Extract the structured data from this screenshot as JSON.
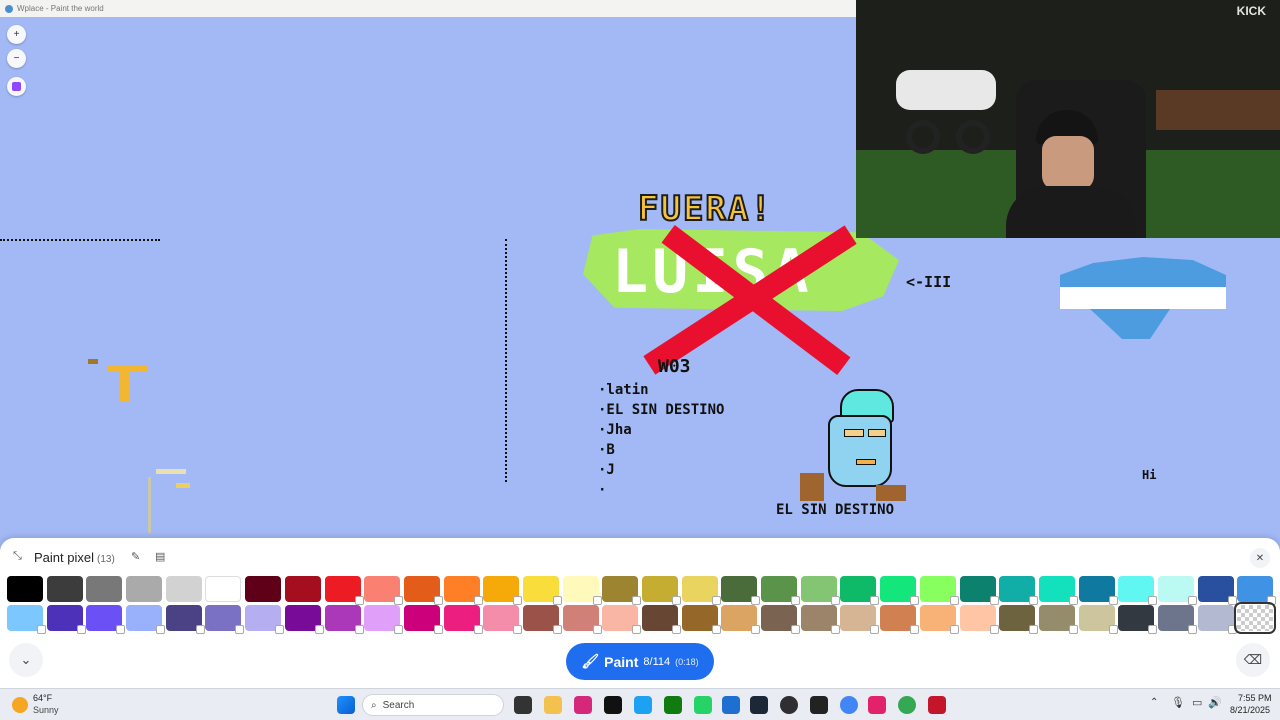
{
  "window": {
    "title": "Wplace - Paint the world"
  },
  "map_controls": {
    "zoom_in": "+",
    "zoom_out": "−"
  },
  "art": {
    "fuera": "FUERA!",
    "luisa": "LUISA",
    "arrow": "<-III",
    "code": "W03",
    "list": [
      "·latin",
      "·EL SIN DESTINO",
      "·Jha",
      "·B",
      "·J",
      "·"
    ],
    "caption": "EL SIN DESTINO",
    "hi": "Hi"
  },
  "panel": {
    "title": "Paint pixel",
    "count": "(13)",
    "paint_label": "Paint",
    "paint_charges": "8/114",
    "paint_timer": "(0:18)"
  },
  "palette": [
    "#000000",
    "#3c3c3c",
    "#787878",
    "#aaaaaa",
    "#d2d2d2",
    "#ffffff",
    "#600018",
    "#a50e1e",
    "#ed1c24",
    "#fa8072",
    "#e45c1a",
    "#ff7f27",
    "#f6aa09",
    "#f9dd3b",
    "#fffabc",
    "#9c8431",
    "#c5ad31",
    "#e8d45f",
    "#4a6b3a",
    "#5a944a",
    "#84c573",
    "#0eb968",
    "#13e67b",
    "#87ff5e",
    "#0c816e",
    "#10aea6",
    "#13e1be",
    "#0f799f",
    "#60f7f2",
    "#bbfaf2",
    "#28509e",
    "#4093e4",
    "#7dc7ff",
    "#4d31b8",
    "#6b50f6",
    "#99b1fb",
    "#4a4284",
    "#7a71c4",
    "#b5aef1",
    "#780c99",
    "#aa38b9",
    "#e09ff9",
    "#cb007a",
    "#ec1f80",
    "#f38da9",
    "#9b5249",
    "#d18078",
    "#fab6a4",
    "#684634",
    "#95682a",
    "#dba463",
    "#7b6352",
    "#9c846b",
    "#d6b594",
    "#d18051",
    "#f8b277",
    "#ffc5a5",
    "#6d643f",
    "#948c6b",
    "#cdc59e",
    "#333941",
    "#6d758d",
    "#b3b9d1",
    "transparent"
  ],
  "taskbar": {
    "weather_temp": "64°F",
    "weather_desc": "Sunny",
    "search": "Search",
    "time": "7:55 PM",
    "date": "8/21/2025"
  },
  "webcam": {
    "brand": "KICK"
  }
}
